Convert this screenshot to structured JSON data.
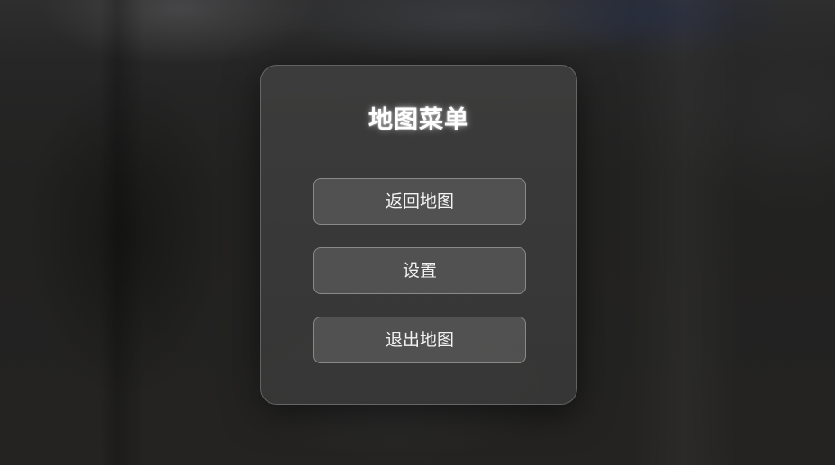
{
  "menu": {
    "title": "地图菜单",
    "buttons": [
      {
        "label": "返回地图"
      },
      {
        "label": "设置"
      },
      {
        "label": "退出地图"
      }
    ]
  },
  "colors": {
    "panel_bg": "#3c3c3c",
    "button_bg": "#525252",
    "text": "#ffffff"
  }
}
